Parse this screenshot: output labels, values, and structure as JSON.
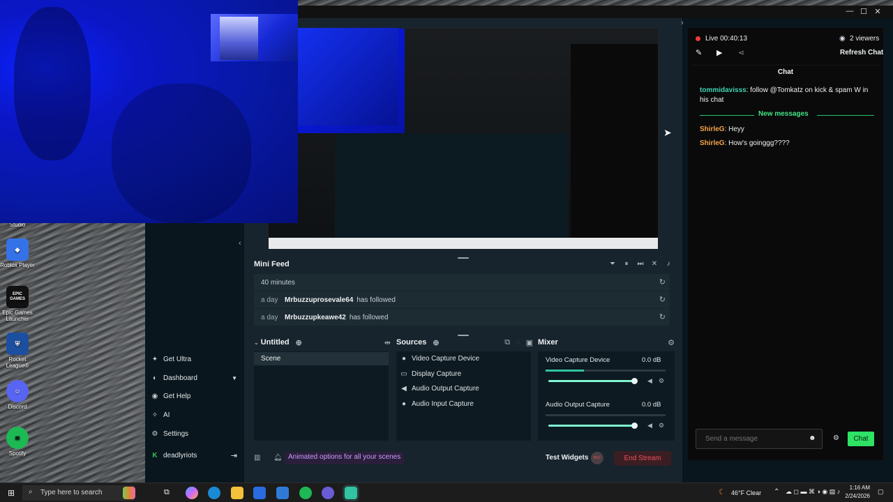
{
  "desktop": {
    "icons": [
      {
        "label": "Studio"
      },
      {
        "label": "Roblox Player"
      },
      {
        "label": "Epic Games Launcher",
        "logo_text": "EPIC GAMES"
      },
      {
        "label": "Rocket League®"
      },
      {
        "label": "Discord"
      },
      {
        "label": "Spotify"
      }
    ]
  },
  "app": {
    "nav": {
      "items": [
        {
          "label": "Get Ultra",
          "icon": "ultra-icon"
        },
        {
          "label": "Dashboard",
          "icon": "dashboard-icon"
        },
        {
          "label": "Get Help",
          "icon": "help-icon"
        },
        {
          "label": "AI",
          "icon": "ai-icon"
        },
        {
          "label": "Settings",
          "icon": "gear-icon"
        }
      ],
      "user": "deadlyriots"
    },
    "mini_feed": {
      "title": "Mini Feed",
      "rows": [
        {
          "when": "40 minutes",
          "user": "",
          "action": ""
        },
        {
          "when": "a day",
          "user": "Mrbuzzuprosevale64",
          "action": "has followed"
        },
        {
          "when": "a day",
          "user": "Mrbuzzupkeawe42",
          "action": "has followed"
        }
      ]
    },
    "scenes": {
      "title": "Untitled",
      "items": [
        "Scene"
      ]
    },
    "sources": {
      "title": "Sources",
      "items": [
        {
          "label": "Video Capture Device",
          "icon": "camera-icon"
        },
        {
          "label": "Display Capture",
          "icon": "monitor-icon"
        },
        {
          "label": "Audio Output Capture",
          "icon": "speaker-icon"
        },
        {
          "label": "Audio Input Capture",
          "icon": "mic-icon"
        }
      ]
    },
    "mixer": {
      "title": "Mixer",
      "channels": [
        {
          "name": "Video Capture Device",
          "db": "0.0 dB",
          "level": 0.32,
          "volume": 0.98
        },
        {
          "name": "Audio Output Capture",
          "db": "0.0 dB",
          "level": 0.0,
          "volume": 0.98
        }
      ]
    },
    "footer": {
      "promo": "Animated options for all your scenes",
      "test_widgets": "Test Widgets",
      "rec": "REC",
      "end_stream": "End Stream"
    },
    "stream": {
      "status": "Live 00:40:13",
      "viewers": "2 viewers",
      "refresh_chat": "Refresh Chat"
    },
    "chat": {
      "title": "Chat",
      "messages": [
        {
          "user": "tommidavisss",
          "text": ": follow @Tomkatz on kick & spam W in his chat"
        },
        {
          "user": "ShirleG",
          "text": ": Heyy"
        },
        {
          "user": "ShirleG",
          "text": ": How's goinggg????"
        }
      ],
      "new_messages": "New messages",
      "placeholder": "Send a message",
      "send_label": "Chat"
    }
  },
  "taskbar": {
    "search_placeholder": "Type here to search",
    "weather": "46°F  Clear",
    "time": "1:16 AM",
    "date": "2/24/2026"
  },
  "colors": {
    "accent_green": "#2ee264",
    "teal": "#31c3a2",
    "live_red": "#f03a3a",
    "end_stream_red": "#f44f5e",
    "chat_user_teal": "#3fd3b1",
    "chat_user_orange": "#f3a34a"
  }
}
